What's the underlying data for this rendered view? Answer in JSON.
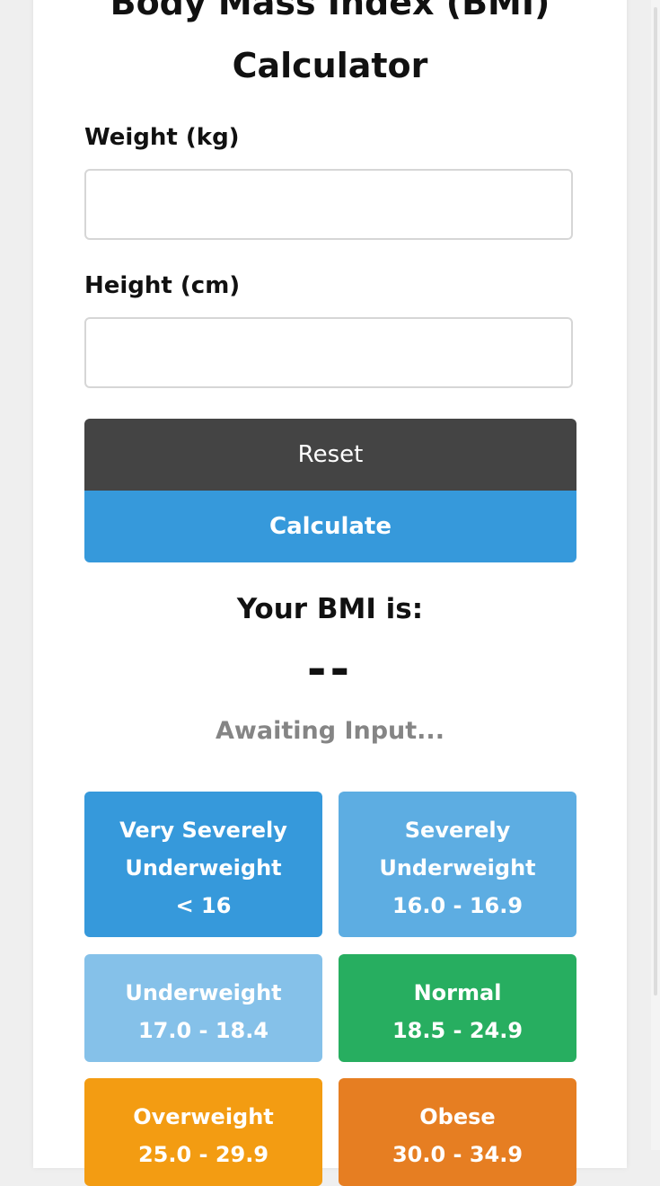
{
  "title_line1": "Body Mass Index (BMI)",
  "title_line2": "Calculator",
  "weight": {
    "label": "Weight (kg)",
    "value": "",
    "placeholder": ""
  },
  "height": {
    "label": "Height (cm)",
    "value": "",
    "placeholder": ""
  },
  "buttons": {
    "reset": "Reset",
    "calculate": "Calculate"
  },
  "result": {
    "heading": "Your BMI is:",
    "value": "--",
    "status": "Awaiting Input..."
  },
  "categories": [
    {
      "name_line1": "Very Severely",
      "name_line2": "Underweight",
      "range": "< 16",
      "color": "#3699db"
    },
    {
      "name_line1": "Severely",
      "name_line2": "Underweight",
      "range": "16.0 - 16.9",
      "color": "#5dade2"
    },
    {
      "name_line1": "Underweight",
      "range": "17.0 - 18.4",
      "color": "#85c1e9"
    },
    {
      "name_line1": "Normal",
      "range": "18.5 - 24.9",
      "color": "#27ae60"
    },
    {
      "name_line1": "Overweight",
      "range": "25.0 - 29.9",
      "color": "#f39c12"
    },
    {
      "name_line1": "Obese",
      "range": "30.0 - 34.9",
      "color": "#e67e22"
    }
  ]
}
